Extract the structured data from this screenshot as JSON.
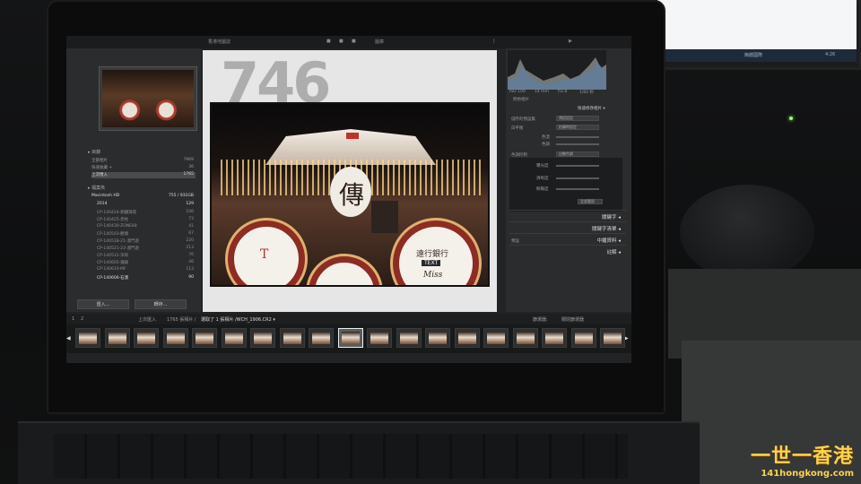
{
  "topbar": {
    "module_left": "香港地圖誌",
    "module_a": "圖庫",
    "module_b": "■",
    "module_c": "■",
    "module_d": "■",
    "module_e": "▶",
    "end": "|"
  },
  "left": {
    "catalog_head": "▸ 目錄",
    "catalog_items": [
      {
        "label": "全部相片",
        "count": "7969"
      },
      {
        "label": "快速收藏 +",
        "count": "36"
      },
      {
        "label": "上次匯入",
        "count": "1765"
      }
    ],
    "folders_head": "▸ 檔案夾",
    "drive": {
      "label": "Macintosh HD",
      "count": "755 / 931GB"
    },
    "folders": [
      {
        "label": "2014",
        "count": "129"
      },
      {
        "label": "CP-140424-銅鑼灣夜",
        "count": "106"
      },
      {
        "label": "CP-140425-赤柱",
        "count": "73"
      },
      {
        "label": "CP-140430-ZONE68",
        "count": "41"
      },
      {
        "label": "CP-140503-觀塘",
        "count": "67"
      },
      {
        "label": "CP-140518-21-澳門遊",
        "count": "220"
      },
      {
        "label": "CP-140521-23-澳門遊",
        "count": "213"
      },
      {
        "label": "CP-140531-深圳",
        "count": "76"
      },
      {
        "label": "CP-140605-鐘錶",
        "count": "46"
      },
      {
        "label": "CP-140610-MF",
        "count": "113"
      },
      {
        "label": "CP-140606-石澳",
        "count": "90"
      }
    ],
    "import_button": "匯入...",
    "export_button": "轉存..."
  },
  "center": {
    "big_number": "746",
    "photo_title": "傳",
    "circle_left_text": "T",
    "circle_right_text": "遠行銀行",
    "circle_right_tag": "TEXT",
    "circle_right_script": "Miss"
  },
  "right": {
    "histogram_caption": "原始相片",
    "histogram_values": [
      "ISO 100",
      "14 mm",
      "f/2.8",
      "1/60 秒"
    ],
    "quick_dev_head": "快速修改相片 ▾",
    "saved_preset_label": "儲存的預設集",
    "saved_preset_value": "預設設定",
    "wb_label": "白平衡",
    "wb_value": "拍攝時設定",
    "temp_label": "色溫",
    "tint_label": "色調",
    "tone_label": "色調控制",
    "auto_tone": "自動色調",
    "exposure_label": "曝光度",
    "clarity_label": "清晰度",
    "vibrance_label": "鮮豔度",
    "reset_all": "全部重設",
    "sections": [
      "關鍵字 ◂",
      "關鍵字清單 ◂",
      "中繼資料 ◂",
      "註解 ◂"
    ],
    "metadata_preset": "預設"
  },
  "bottombar": {
    "page": "1",
    "page2": "2",
    "source": "上次匯入",
    "counts": "1765 張相片 /",
    "selected": "選取了 1 張相片 /WCH_1906.CR2 ▾",
    "filter_label": "篩選器:",
    "filter_value": "關閉篩選器"
  },
  "filmstrip": {
    "thumb_count": 19,
    "selected_index": 9
  },
  "background": {
    "taskbar_text": "簡體國際",
    "clock": "4:26"
  },
  "watermark": {
    "main": "一世一香港",
    "sub": "141hongkong.com"
  }
}
